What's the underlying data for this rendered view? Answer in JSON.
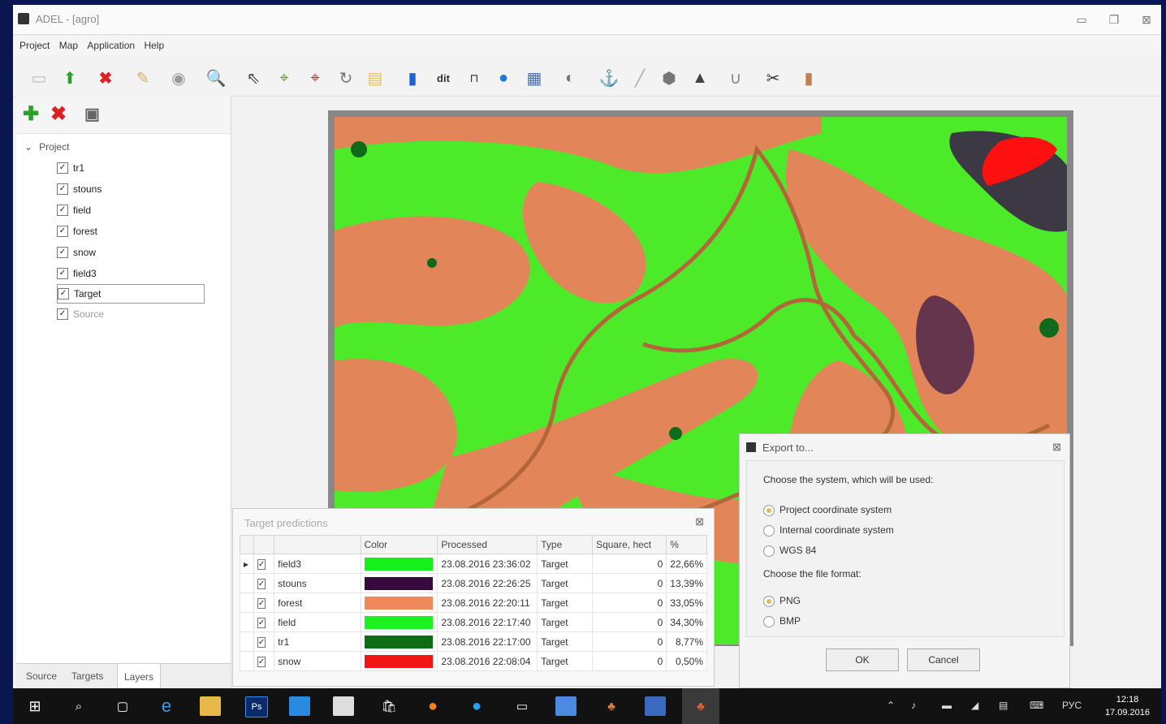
{
  "window": {
    "title": "ADEL - [agro]",
    "controls": [
      "▭",
      "❐",
      "⊠"
    ]
  },
  "menu": [
    "Project",
    "Map",
    "Application",
    "Help"
  ],
  "toolbar_icons": [
    "new-file-icon",
    "add-icon",
    "delete-icon",
    "edit-icon",
    "circle-icon",
    "zoom-icon",
    "select-arrow-icon",
    "select-region-icon",
    "select-region-red-icon",
    "rotate-icon",
    "folder-icon",
    "color-bars-icon",
    "dit-icon",
    "filter-icon",
    "globe-icon",
    "chart-icon",
    "layers-icon",
    "pin-icon",
    "line-icon",
    "sphere-icon",
    "cursor-icon",
    "magnet-icon",
    "scissors-icon",
    "column-icon"
  ],
  "toolbar_dit_label": "dit",
  "left_panel": {
    "tools": [
      "add-layer-icon",
      "remove-layer-icon",
      "save-icon"
    ],
    "root": "Project",
    "items": [
      {
        "label": "tr1",
        "checked": true
      },
      {
        "label": "stouns",
        "checked": true
      },
      {
        "label": "field",
        "checked": true
      },
      {
        "label": "forest",
        "checked": true
      },
      {
        "label": "snow",
        "checked": true
      },
      {
        "label": "field3",
        "checked": true
      },
      {
        "label": "Target",
        "checked": true
      },
      {
        "label": "Source",
        "checked": true
      }
    ],
    "tabs": [
      "Source",
      "Targets",
      "Layers"
    ]
  },
  "predictions": {
    "title": "Target predictions",
    "columns": [
      "",
      "",
      "",
      "Color",
      "Processed",
      "Type",
      "Square, hect",
      "%"
    ],
    "rows": [
      {
        "arrow": "▸",
        "name": "field3",
        "color": "#16f016",
        "processed": "23.08.2016 23:36:02",
        "type": "Target",
        "square": "0",
        "pct": "22,66%"
      },
      {
        "arrow": "",
        "name": "stouns",
        "color": "#360a3a",
        "processed": "23.08.2016 22:26:25",
        "type": "Target",
        "square": "0",
        "pct": "13,39%"
      },
      {
        "arrow": "",
        "name": "forest",
        "color": "#f0885a",
        "processed": "23.08.2016 22:20:11",
        "type": "Target",
        "square": "0",
        "pct": "33,05%"
      },
      {
        "arrow": "",
        "name": "field",
        "color": "#1ef21e",
        "processed": "23.08.2016 22:17:40",
        "type": "Target",
        "square": "0",
        "pct": "34,30%"
      },
      {
        "arrow": "",
        "name": "tr1",
        "color": "#0b6e14",
        "processed": "23.08.2016 22:17:00",
        "type": "Target",
        "square": "0",
        "pct": "8,77%"
      },
      {
        "arrow": "",
        "name": "snow",
        "color": "#f01616",
        "processed": "23.08.2016 22:08:04",
        "type": "Target",
        "square": "0",
        "pct": "0,50%"
      }
    ]
  },
  "export": {
    "title": "Export to...",
    "prompt_system": "Choose the system, which will be used:",
    "systems": [
      {
        "label": "Project coordinate system",
        "selected": true
      },
      {
        "label": "Internal coordinate system",
        "selected": false
      },
      {
        "label": "WGS 84",
        "selected": false
      }
    ],
    "prompt_format": "Choose the file format:",
    "formats": [
      {
        "label": "PNG",
        "selected": true
      },
      {
        "label": "BMP",
        "selected": false
      }
    ],
    "ok": "OK",
    "cancel": "Cancel"
  },
  "taskbar": {
    "apps": [
      "windows-start-icon",
      "search-icon",
      "task-view-icon",
      "edge-icon",
      "file-explorer-icon",
      "photoshop-icon",
      "store-app-icon",
      "calculator-icon",
      "store-icon",
      "firefox-icon",
      "skype-icon",
      "window-icon",
      "app-icon",
      "game-icon",
      "word-icon",
      "adel-icon"
    ],
    "photoshop_label": "Ps",
    "lang": "РУС",
    "time": "12:18",
    "date": "17.09.2016"
  },
  "colors": {
    "map_green": "#4dea2a",
    "map_orange": "#e2865a",
    "map_purple": "#3a1a4a",
    "map_dark_green": "#0f6a1c",
    "map_red": "#ff1010"
  }
}
